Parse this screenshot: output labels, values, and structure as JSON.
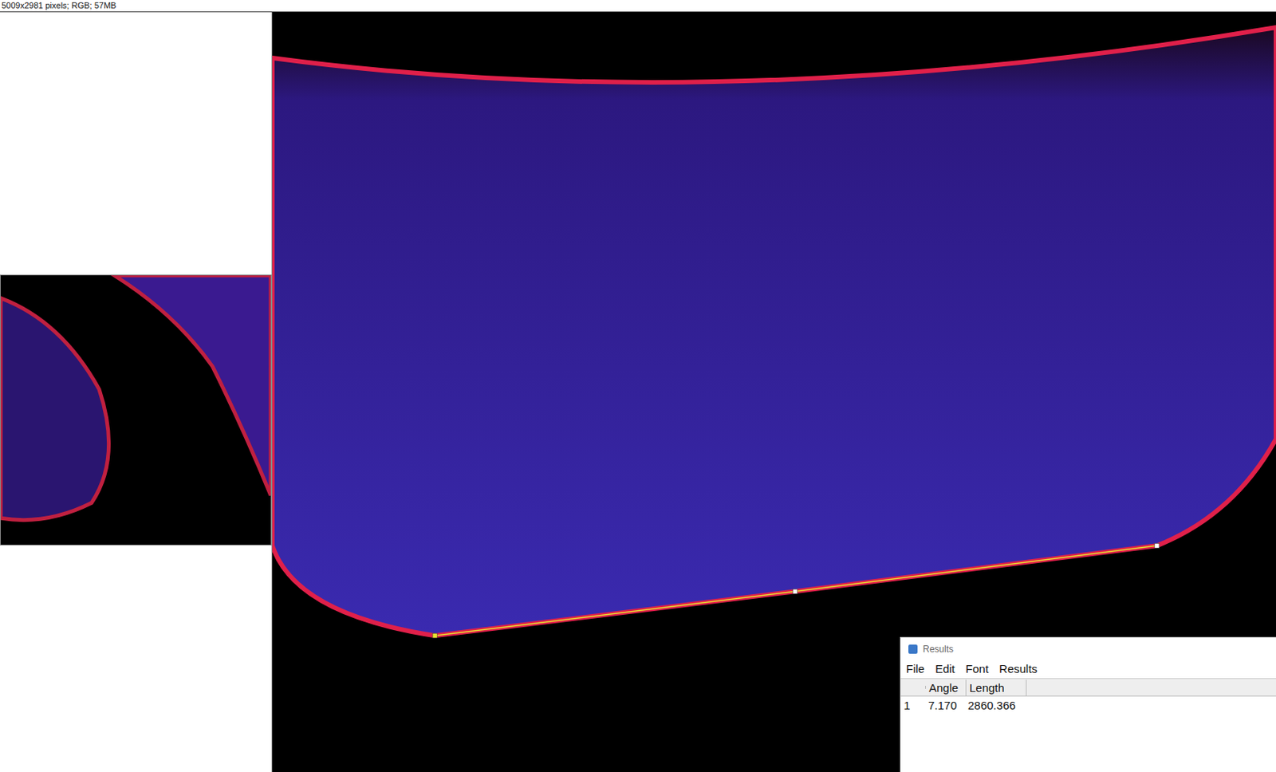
{
  "image_info": "5009x2981 pixels; RGB; 57MB",
  "results": {
    "title": "Results",
    "menu": [
      "File",
      "Edit",
      "Font",
      "Results"
    ],
    "columns": [
      "Angle",
      "Length"
    ],
    "rows": [
      {
        "index": "1",
        "cells": [
          "7.170",
          "2860.366"
        ]
      }
    ]
  }
}
